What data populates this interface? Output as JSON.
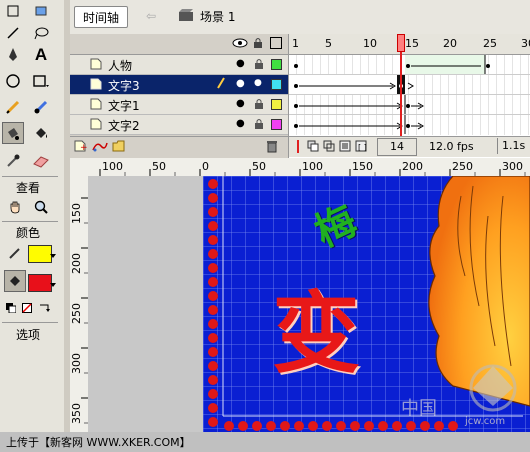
{
  "toolbox": {
    "view_label": "查看",
    "color_label": "颜色",
    "options_label": "选项",
    "stroke_color": "#fffc00",
    "fill_color": "#e8101a"
  },
  "timeline": {
    "tab_label": "时间轴",
    "scene_label": "场景 1",
    "frame_numbers": [
      "1",
      "5",
      "10",
      "15",
      "20",
      "25",
      "30"
    ],
    "current_frame": "14",
    "fps": "12.0 fps",
    "elapsed": "1.1s",
    "layers": [
      {
        "name": "人物",
        "color": "#40e040"
      },
      {
        "name": "文字3",
        "color": "#40e0f0"
      },
      {
        "name": "文字1",
        "color": "#f0f040"
      },
      {
        "name": "文字2",
        "color": "#f040f0"
      }
    ]
  },
  "stage": {
    "ruler_top": [
      "100",
      "50",
      "0",
      "50",
      "100",
      "150",
      "200",
      "250",
      "300"
    ],
    "ruler_left": [
      "150",
      "200",
      "250",
      "300",
      "350"
    ],
    "main_char": "变",
    "small_char": "梅",
    "watermark": "中国",
    "watermark_url": "jcw.com",
    "canvas_bg": "#0a1fd2"
  },
  "status": {
    "text": "上传于【新客网 WWW.XKER.COM】"
  }
}
